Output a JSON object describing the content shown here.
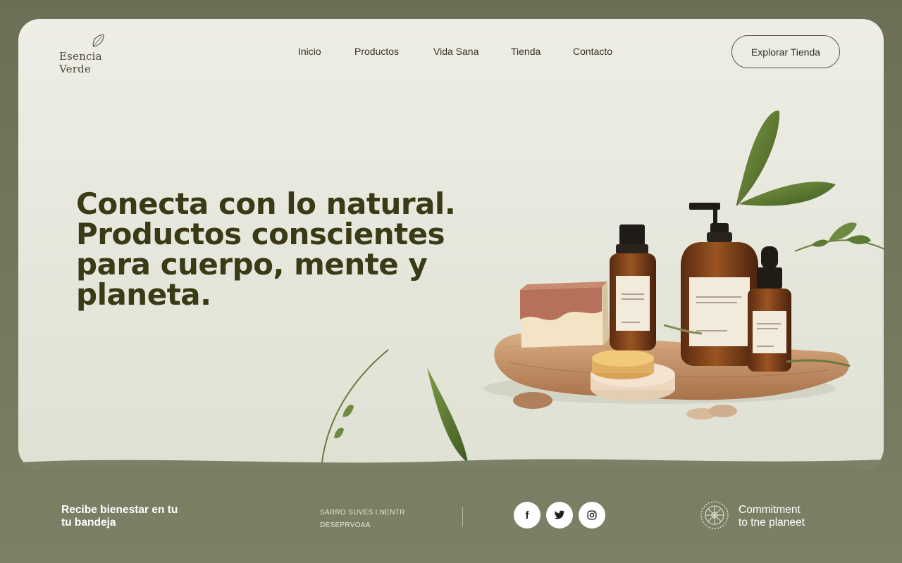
{
  "brand": {
    "name": "Esencia Verde",
    "logo_icon": "leaf-icon"
  },
  "nav": {
    "items": [
      {
        "label": "Inicio"
      },
      {
        "label": "Productos"
      },
      {
        "label": "Vida Sana"
      },
      {
        "label": "Tienda"
      },
      {
        "label": "Contacto"
      }
    ],
    "cta_label": "Explorar Tienda"
  },
  "hero": {
    "title_lines": [
      "Conecta con lo natural.",
      "Productos conscientes",
      "para cuerpo, mente y",
      "planeta."
    ]
  },
  "footer": {
    "newsletter_lines": [
      "Recibe bienestar en tu",
      "tu bandeja"
    ],
    "mini_text_lines": [
      "SARRO SUVES I.NENTR",
      "DESEPRVOAA"
    ],
    "socials": [
      {
        "icon": "facebook-icon",
        "glyph": "f"
      },
      {
        "icon": "twitter-icon",
        "glyph": "🐦"
      },
      {
        "icon": "instagram-icon",
        "glyph": "◎"
      }
    ],
    "commitment_lines": [
      "Commitment",
      "to tne planeet"
    ]
  },
  "colors": {
    "frame": "#6d7156",
    "card": "#eeede6",
    "headline": "#3b3a17",
    "accent_leaf": "#5c7a3a"
  }
}
